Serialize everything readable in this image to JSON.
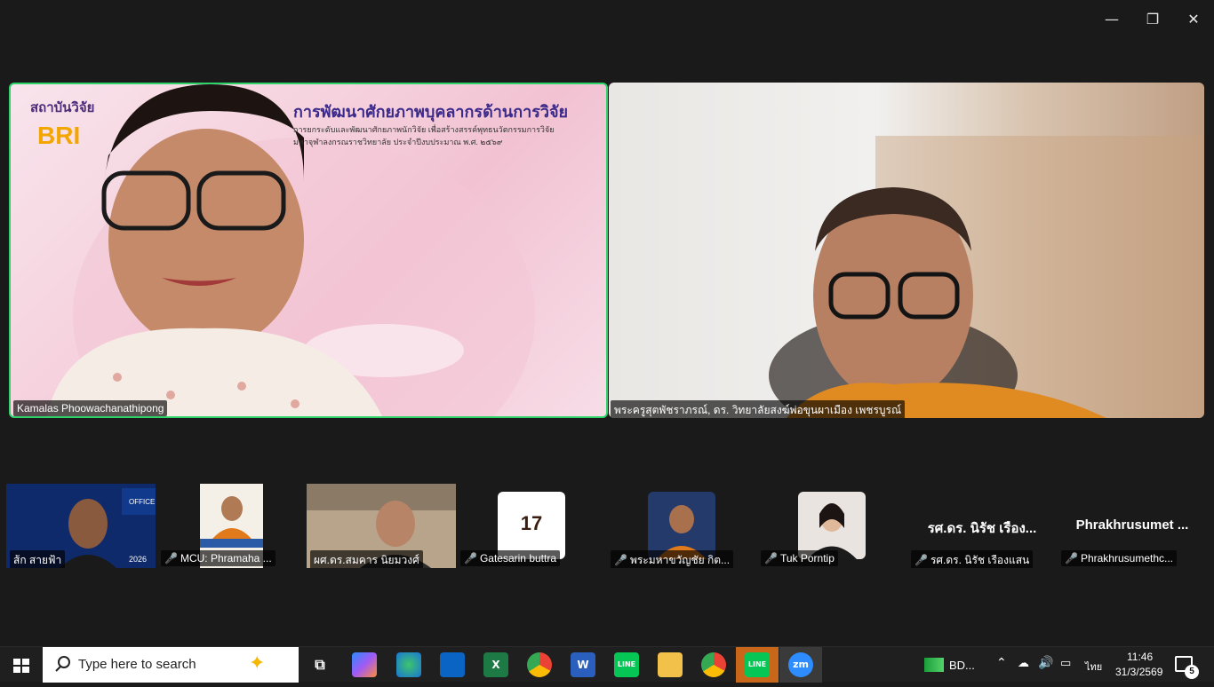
{
  "window": {
    "minimize_glyph": "—",
    "restore_glyph": "❐",
    "close_glyph": "✕"
  },
  "main_tiles": {
    "left": {
      "name": "Kamalas Phoowachanathipong",
      "banner_logo": "สถาบันวิจัย",
      "banner_bri": "BRI",
      "banner_title": "การพัฒนาศักยภาพบุคลากรด้านการวิจัย",
      "banner_sub1": "การยกระดับและพัฒนาศักยภาพนักวิจัย เพื่อสร้างสรรค์พุทธนวัตกรรมการวิจัย",
      "banner_sub2": "มหาจุฬาลงกรณราชวิทยาลัย ประจำปีงบประมาณ พ.ศ. ๒๕๖๙"
    },
    "right": {
      "name": "พระครูสุตพัชราภรณ์, ดร. วิทยาลัยสงฆ์พ่อขุนผาเมือง เพชรบูรณ์"
    }
  },
  "thumbnails": [
    {
      "name": "ส้ก สายฟ้า",
      "muted": false
    },
    {
      "name": "MCU: Phramaha ...",
      "muted": true
    },
    {
      "name": "ผศ.ดร.สมคาร นิยมวงศ์",
      "muted": false
    },
    {
      "name": "Gatesarin buttra",
      "muted": true
    },
    {
      "name": "พระมหาขวัญชัย กิต...",
      "muted": true
    },
    {
      "name": "Tuk Porntip",
      "muted": true
    },
    {
      "name": "รศ.ดร. นิรัช เรืองแสน",
      "muted": true,
      "avatar_text": "รศ.ดร. นิรัช เรือง..."
    },
    {
      "name": "Phrakhrusumethc...",
      "muted": true,
      "avatar_text": "Phrakhrusumet ..."
    }
  ],
  "thumb_content": {
    "badge_17": "17",
    "project_label": "OFFICER",
    "project_year": "2026"
  },
  "taskbar": {
    "search_placeholder": "Type here to search",
    "weather_label": "BD...",
    "language": "ไทย",
    "time": "11:46",
    "date": "31/3/2569",
    "notification_count": "5",
    "app_labels": {
      "excel": "X",
      "word": "W",
      "line": "LINE",
      "zoom": "zm"
    }
  },
  "colors": {
    "active_speaker_border": "#2ed36a",
    "muted_icon": "#e03b3b",
    "taskbar_bg": "#1f1f1f"
  }
}
